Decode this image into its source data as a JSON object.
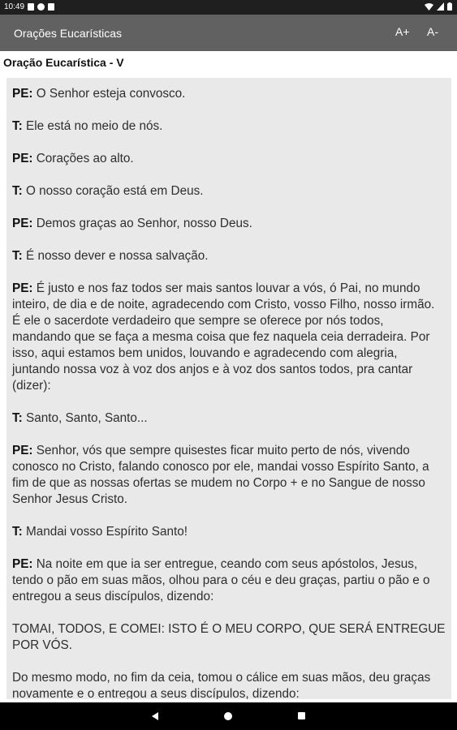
{
  "status_bar": {
    "time": "10:49"
  },
  "app_bar": {
    "title": "Orações Eucarísticas",
    "increase_font_label": "A+",
    "decrease_font_label": "A-"
  },
  "section": {
    "title": "Oração Eucarística - V"
  },
  "content": {
    "paragraphs": [
      {
        "speaker": "PE:",
        "text": " O Senhor esteja convosco."
      },
      {
        "speaker": "T:",
        "text": " Ele está no meio de nós."
      },
      {
        "speaker": "PE:",
        "text": " Corações ao alto."
      },
      {
        "speaker": "T:",
        "text": " O nosso coração está em Deus."
      },
      {
        "speaker": "PE:",
        "text": " Demos graças ao Senhor, nosso Deus."
      },
      {
        "speaker": "T:",
        "text": " É nosso dever e nossa salvação."
      },
      {
        "speaker": "PE:",
        "text": " É justo e nos faz todos ser mais santos louvar a vós, ó Pai, no mundo inteiro, de dia e de noite, agradecendo com Cristo, vosso Filho, nosso irmão. É ele o sacerdote verdadeiro que sempre se oferece por nós todos, mandando que se faça a mesma coisa que fez naquela ceia derradeira. Por isso, aqui estamos bem unidos, louvando e agradecendo com alegria, juntando nossa voz à voz dos anjos e à voz dos santos todos, pra cantar (dizer):"
      },
      {
        "speaker": "T:",
        "text": " Santo, Santo, Santo..."
      },
      {
        "speaker": "PE:",
        "text": " Senhor, vós que sempre quisestes ficar muito perto de nós, vivendo conosco no Cristo, falando conosco por ele, mandai vosso Espírito Santo, a fim de que as nossas ofertas se mudem no Corpo + e no Sangue de nosso Senhor Jesus Cristo."
      },
      {
        "speaker": "T:",
        "text": " Mandai vosso Espírito Santo!"
      },
      {
        "speaker": "PE:",
        "text": " Na noite em que ia ser entregue, ceando com seus apóstolos, Jesus, tendo o pão em suas mãos, olhou para o céu e deu graças, partiu o pão e o entregou a seus discípulos, dizendo:"
      },
      {
        "speaker": "",
        "text": "TOMAI, TODOS, E COMEI: ISTO É O MEU CORPO, QUE SERÁ ENTREGUE POR VÓS."
      },
      {
        "speaker": "",
        "text": "Do mesmo modo, no fim da ceia, tomou o cálice em suas mãos, deu graças novamente e o entregou a seus discípulos, dizendo:"
      }
    ]
  }
}
